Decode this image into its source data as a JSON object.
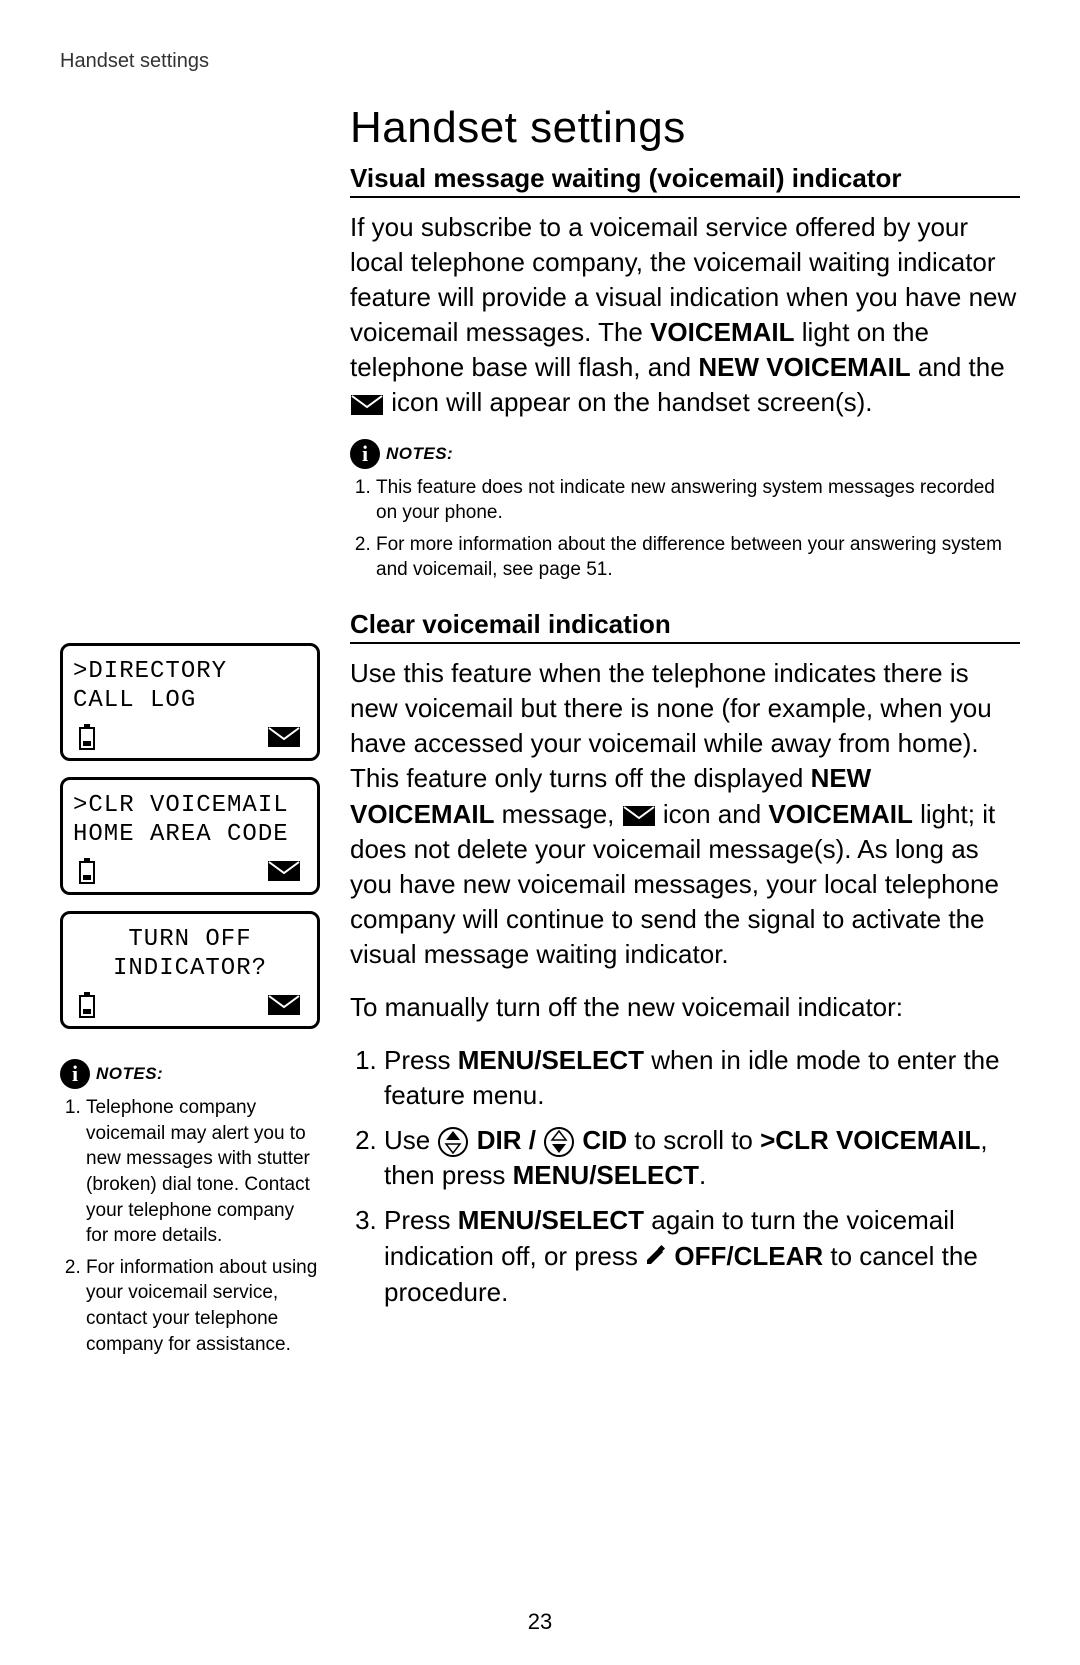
{
  "header": {
    "crumb": "Handset settings"
  },
  "page_number": "23",
  "title": "Handset settings",
  "section1": {
    "heading": "Visual message waiting (voicemail) indicator",
    "para_a": "If you subscribe to a voicemail service offered by your local telephone company, the voicemail waiting indicator feature will provide a visual indication when you have new voicemail messages. The ",
    "word_voicemail": "VOICEMAIL",
    "para_b": " light on the telephone base will flash, and ",
    "word_newvm": "NEW VOICEMAIL",
    "para_c": " and the ",
    "para_d": " icon will appear on the handset screen(s)."
  },
  "notes_right": {
    "label": "NOTES:",
    "items": [
      "This feature does not indicate new answering system messages recorded on your phone.",
      "For more information about the difference between your answering system and voicemail, see page 51."
    ]
  },
  "section2": {
    "heading": "Clear voicemail indication",
    "para_a": "Use this feature when the telephone indicates there is new voicemail but there is none (for example, when you have accessed your voicemail while away from home). This feature only turns off the displayed ",
    "word_newvm": "NEW VOICEMAIL",
    "para_b": " message, ",
    "para_c": " icon and ",
    "word_voicemail": "VOICEMAIL",
    "para_d": " light; it does not delete your voicemail message(s). As long as you have new voicemail messages, your local telephone company will continue to send the signal to activate the visual message waiting indicator.",
    "para_e": "To manually turn off the new voicemail indicator:"
  },
  "steps": {
    "s1a": "Press ",
    "s1_menu": "MENU/",
    "s1_select": "SELECT",
    "s1b": " when in idle mode to enter the feature menu.",
    "s2a": "Use ",
    "s2_dir": " DIR / ",
    "s2_cid": " CID",
    "s2b": " to scroll to ",
    "s2_clr": ">CLR VOICEMAIL",
    "s2c": ", then press ",
    "s2_menu2": "MENU/SELECT",
    "s2d": ".",
    "s3a": "Press ",
    "s3_menu": "MENU",
    "s3_select": "/SELECT",
    "s3b": " again to turn the voicemail indication off, or press ",
    "s3_off": "OFF",
    "s3_clear": "/CLEAR",
    "s3c": " to cancel the procedure."
  },
  "screens": {
    "s1": {
      "line1": ">DIRECTORY",
      "line2": " CALL LOG"
    },
    "s2": {
      "line1": ">CLR VOICEMAIL",
      "line2": " HOME AREA CODE"
    },
    "s3": {
      "line1": "TURN OFF",
      "line2": "INDICATOR?"
    }
  },
  "notes_left": {
    "label": "NOTES:",
    "items": [
      "Telephone company voicemail may alert you to new messages with stutter (broken) dial tone. Contact your telephone company for more details.",
      "For information about using your voicemail service, contact your telephone company for assistance."
    ]
  }
}
